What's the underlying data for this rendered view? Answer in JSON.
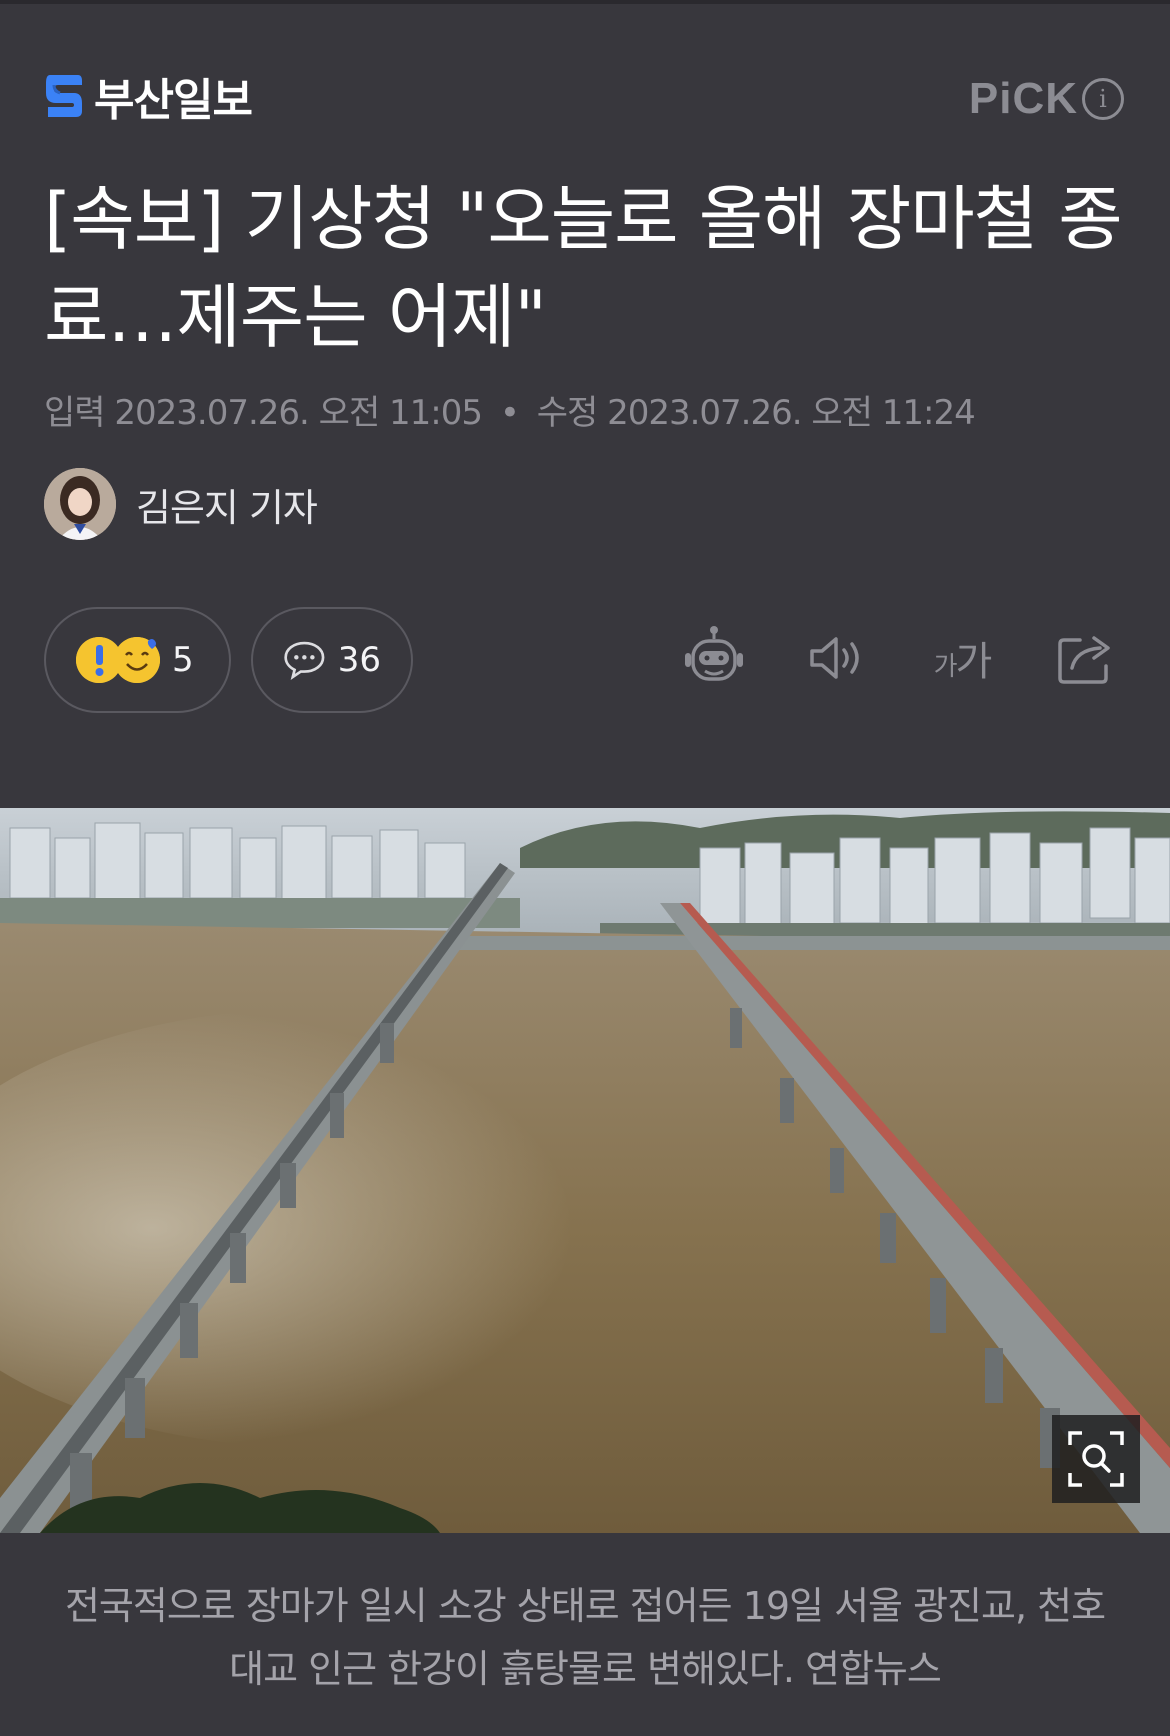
{
  "press": {
    "name": "부산일보"
  },
  "pick": {
    "label": "PiCK",
    "info_glyph": "i"
  },
  "article": {
    "title": "[속보] 기상청 \"오늘로 올해 장마철 종료…제주는 어제\"",
    "published_label": "입력",
    "published": "2023.07.26. 오전 11:05",
    "separator": "•",
    "modified_label": "수정",
    "modified": "2023.07.26. 오전 11:24",
    "reporter": "김은지 기자"
  },
  "actions": {
    "reaction_count": "5",
    "comment_count": "36",
    "font_size_glyph_small": "가",
    "font_size_glyph_large": "가"
  },
  "icons": {
    "press_logo": "busan-ilbo-s-icon",
    "info": "info-icon",
    "reactions": [
      "surprised-emoji-icon",
      "smile-emoji-icon"
    ],
    "comment": "comment-bubble-icon",
    "summary_bot": "robot-icon",
    "tts": "speaker-icon",
    "font_size": "font-size-icon",
    "share": "share-icon",
    "zoom": "zoom-icon"
  },
  "photo": {
    "caption": "전국적으로 장마가 일시 소강 상태로 접어든 19일 서울 광진교, 천호대교 인근 한강이 흙탕물로 변해있다. 연합뉴스"
  },
  "colors": {
    "background": "#38373d",
    "title": "#ffffff",
    "muted": "#8e8d94",
    "logo_blue": "#3b82f6",
    "emoji_yellow": "#f5c42f",
    "river_brown": "#7e6a4a"
  }
}
